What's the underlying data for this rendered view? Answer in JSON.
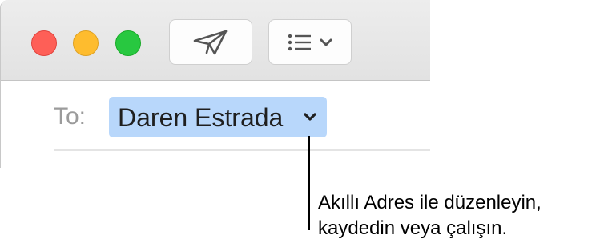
{
  "window": {
    "traffic_lights": {
      "close_color": "#fe5f57",
      "minimize_color": "#febc2e",
      "zoom_color": "#28c840"
    },
    "toolbar": {
      "send_icon": "paper-plane-icon",
      "format_icon": "list-icon",
      "format_chevron_icon": "chevron-down-icon"
    },
    "header": {
      "to_label": "To:",
      "recipient": {
        "name": "Daren Estrada",
        "token_color": "#b8d7fb",
        "chevron_icon": "chevron-down-icon"
      }
    }
  },
  "callout": {
    "line1": "Akıllı Adres ile düzenleyin,",
    "line2": "kaydedin veya çalışın."
  }
}
